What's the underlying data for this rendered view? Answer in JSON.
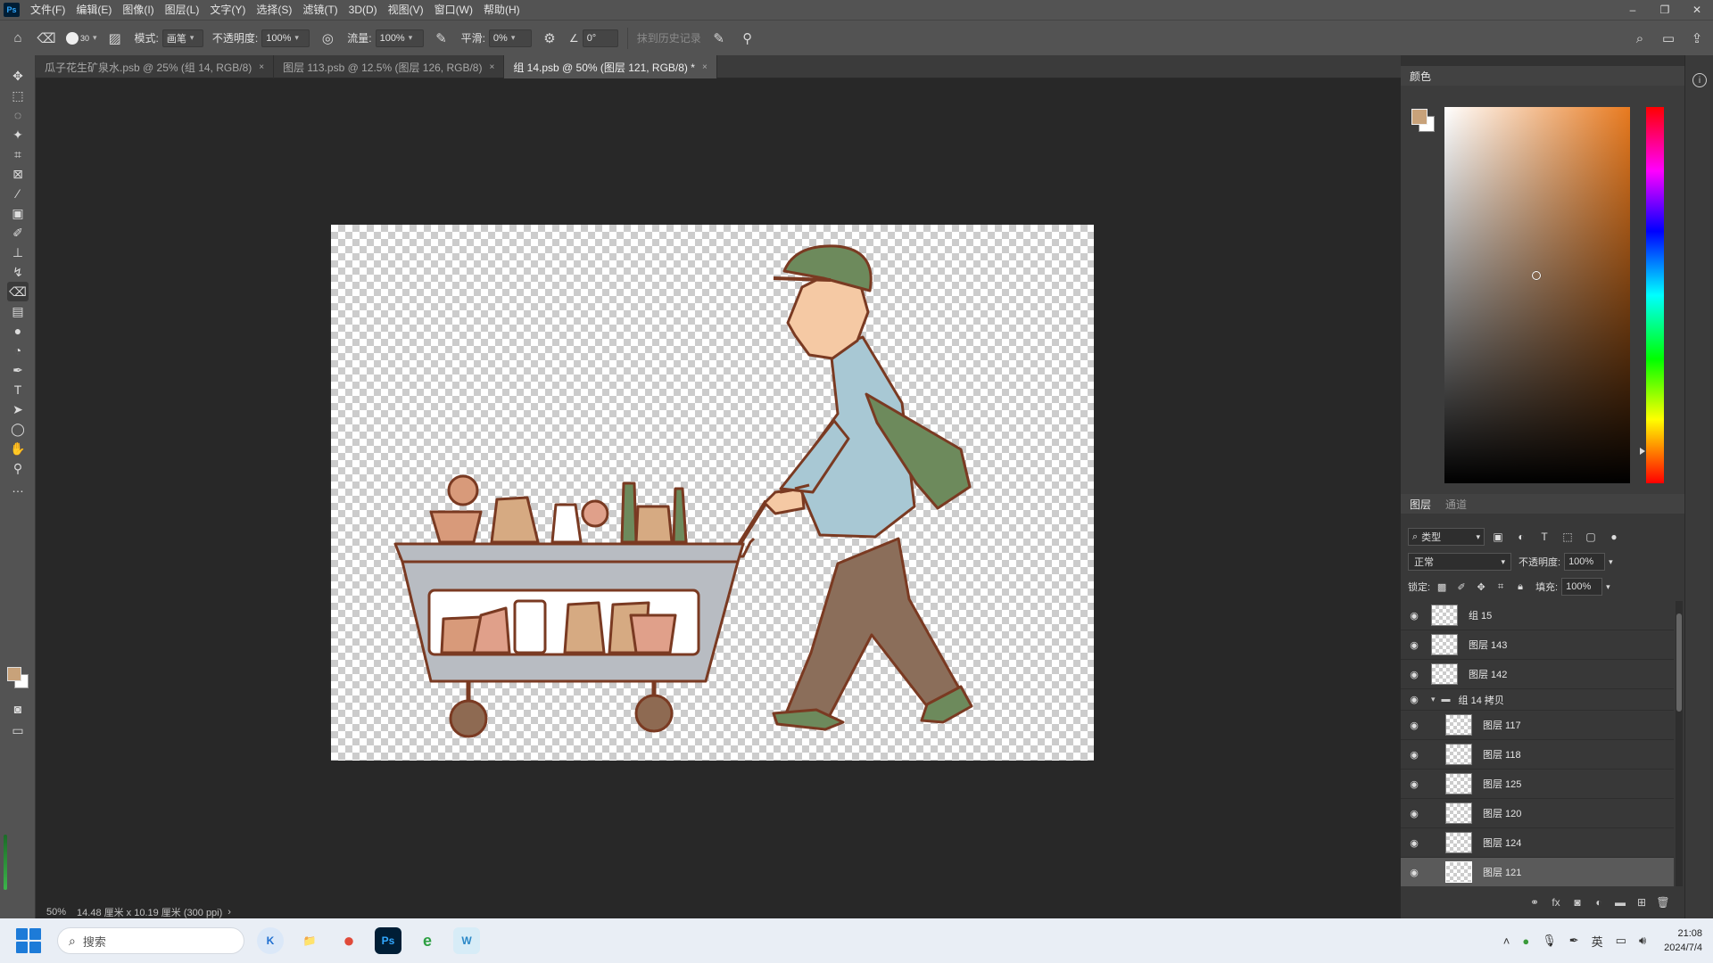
{
  "menubar": {
    "logo": "Ps",
    "items": [
      "文件(F)",
      "编辑(E)",
      "图像(I)",
      "图层(L)",
      "文字(Y)",
      "选择(S)",
      "滤镜(T)",
      "3D(D)",
      "视图(V)",
      "窗口(W)",
      "帮助(H)"
    ],
    "controls": [
      "–",
      "❐",
      "✕"
    ]
  },
  "options": {
    "brush_size": "30",
    "mode_label": "模式:",
    "mode_value": "画笔",
    "opacity_label": "不透明度:",
    "opacity_value": "100%",
    "flow_label": "流量:",
    "flow_value": "100%",
    "smoothing_label": "平滑:",
    "smoothing_value": "0%",
    "angle_value": "0°",
    "history_label": "抹到历史记录"
  },
  "tabs": [
    {
      "label": "瓜子花生矿泉水.psb @ 25% (组 14, RGB/8)",
      "close": "×"
    },
    {
      "label": "图层 113.psb @ 12.5% (图层 126, RGB/8)",
      "close": "×"
    },
    {
      "label": "组 14.psb @ 50% (图层 121, RGB/8) *",
      "close": "×"
    }
  ],
  "status": {
    "zoom": "50%",
    "doc_info": "14.48 厘米 x 10.19 厘米 (300 ppi)",
    "arrow": "›"
  },
  "color_panel": {
    "title": "颜色",
    "foreground": "#c8a27a",
    "background": "#ffffff"
  },
  "layers_panel": {
    "title": "图层",
    "tab2": "通道",
    "kind_filter": "类型",
    "blend_mode": "正常",
    "opacity_label": "不透明度:",
    "opacity_value": "100%",
    "lock_label": "锁定:",
    "fill_label": "填充:",
    "fill_value": "100%",
    "layers": [
      {
        "name": "组 15",
        "type": "layer",
        "indent": false,
        "selected": false
      },
      {
        "name": "图层 143",
        "type": "layer",
        "indent": false,
        "selected": false
      },
      {
        "name": "图层 142",
        "type": "layer",
        "indent": false,
        "selected": false
      },
      {
        "name": "组 14 拷贝",
        "type": "group",
        "indent": false,
        "selected": false
      },
      {
        "name": "图层 117",
        "type": "layer",
        "indent": true,
        "selected": false
      },
      {
        "name": "图层 118",
        "type": "layer",
        "indent": true,
        "selected": false
      },
      {
        "name": "图层 125",
        "type": "layer",
        "indent": true,
        "selected": false
      },
      {
        "name": "图层 120",
        "type": "layer",
        "indent": true,
        "selected": false
      },
      {
        "name": "图层 124",
        "type": "layer",
        "indent": true,
        "selected": false
      },
      {
        "name": "图层 121",
        "type": "layer",
        "indent": true,
        "selected": true
      }
    ]
  },
  "taskbar": {
    "search_placeholder": "搜索",
    "apps": [
      "K",
      "📁",
      "●",
      "Ps",
      "e",
      "W"
    ],
    "ime": "英",
    "time": "21:08",
    "date": "2024/7/4"
  },
  "colors": {
    "accent_hue": "#e87a1f",
    "selected_layer": "#5a5a5a"
  }
}
